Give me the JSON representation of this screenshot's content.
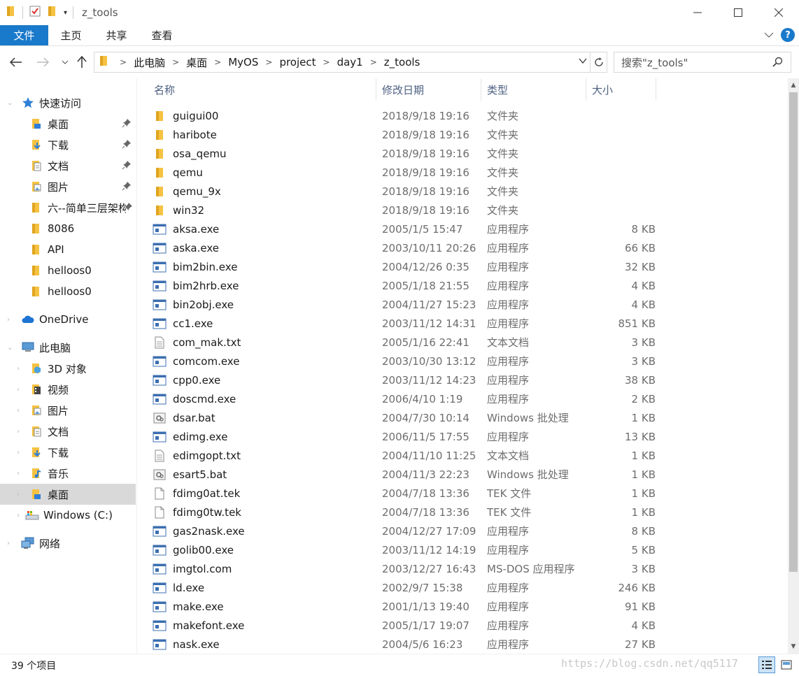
{
  "window": {
    "title": "z_tools"
  },
  "ribbon": {
    "tabs": [
      {
        "label": "文件"
      },
      {
        "label": "主页"
      },
      {
        "label": "共享"
      },
      {
        "label": "查看"
      }
    ],
    "accent": "#1979ca"
  },
  "address": {
    "crumbs": [
      "此电脑",
      "桌面",
      "MyOS",
      "project",
      "day1",
      "z_tools"
    ],
    "search_placeholder": "搜索\"z_tools\""
  },
  "sidebar": {
    "quick_access": {
      "label": "快速访问",
      "icon": "star-icon"
    },
    "quick_items": [
      {
        "label": "桌面",
        "icon": "desktop-folder-icon",
        "pinned": true
      },
      {
        "label": "下载",
        "icon": "download-folder-icon",
        "pinned": true
      },
      {
        "label": "文档",
        "icon": "documents-folder-icon",
        "pinned": true
      },
      {
        "label": "图片",
        "icon": "pictures-folder-icon",
        "pinned": true
      },
      {
        "label": "六--简单三层架构",
        "icon": "folder-icon",
        "pinned": true
      },
      {
        "label": "8086",
        "icon": "folder-icon",
        "pinned": false
      },
      {
        "label": "API",
        "icon": "folder-icon",
        "pinned": false
      },
      {
        "label": "helloos0",
        "icon": "folder-icon",
        "pinned": false
      },
      {
        "label": "helloos0",
        "icon": "folder-icon",
        "pinned": false
      }
    ],
    "onedrive": {
      "label": "OneDrive",
      "icon": "cloud-icon"
    },
    "this_pc": {
      "label": "此电脑",
      "icon": "computer-icon"
    },
    "pc_items": [
      {
        "label": "3D 对象",
        "icon": "3d-objects-icon"
      },
      {
        "label": "视频",
        "icon": "videos-folder-icon"
      },
      {
        "label": "图片",
        "icon": "pictures-folder-icon"
      },
      {
        "label": "文档",
        "icon": "documents-folder-icon"
      },
      {
        "label": "下载",
        "icon": "download-folder-icon"
      },
      {
        "label": "音乐",
        "icon": "music-folder-icon"
      },
      {
        "label": "桌面",
        "icon": "desktop-folder-icon",
        "selected": true
      },
      {
        "label": "Windows (C:)",
        "icon": "drive-icon"
      }
    ],
    "network": {
      "label": "网络",
      "icon": "network-icon"
    }
  },
  "columns": {
    "name": "名称",
    "date": "修改日期",
    "type": "类型",
    "size": "大小"
  },
  "files": [
    {
      "name": "guigui00",
      "date": "2018/9/18 19:16",
      "type": "文件夹",
      "size": "",
      "kind": "folder"
    },
    {
      "name": "haribote",
      "date": "2018/9/18 19:16",
      "type": "文件夹",
      "size": "",
      "kind": "folder"
    },
    {
      "name": "osa_qemu",
      "date": "2018/9/18 19:16",
      "type": "文件夹",
      "size": "",
      "kind": "folder"
    },
    {
      "name": "qemu",
      "date": "2018/9/18 19:16",
      "type": "文件夹",
      "size": "",
      "kind": "folder"
    },
    {
      "name": "qemu_9x",
      "date": "2018/9/18 19:16",
      "type": "文件夹",
      "size": "",
      "kind": "folder"
    },
    {
      "name": "win32",
      "date": "2018/9/18 19:16",
      "type": "文件夹",
      "size": "",
      "kind": "folder"
    },
    {
      "name": "aksa.exe",
      "date": "2005/1/5 15:47",
      "type": "应用程序",
      "size": "8 KB",
      "kind": "exe"
    },
    {
      "name": "aska.exe",
      "date": "2003/10/11 20:26",
      "type": "应用程序",
      "size": "66 KB",
      "kind": "exe"
    },
    {
      "name": "bim2bin.exe",
      "date": "2004/12/26 0:35",
      "type": "应用程序",
      "size": "32 KB",
      "kind": "exe"
    },
    {
      "name": "bim2hrb.exe",
      "date": "2005/1/18 21:55",
      "type": "应用程序",
      "size": "4 KB",
      "kind": "exe"
    },
    {
      "name": "bin2obj.exe",
      "date": "2004/11/27 15:23",
      "type": "应用程序",
      "size": "4 KB",
      "kind": "exe"
    },
    {
      "name": "cc1.exe",
      "date": "2003/11/12 14:31",
      "type": "应用程序",
      "size": "851 KB",
      "kind": "exe"
    },
    {
      "name": "com_mak.txt",
      "date": "2005/1/16 22:41",
      "type": "文本文档",
      "size": "3 KB",
      "kind": "txt"
    },
    {
      "name": "comcom.exe",
      "date": "2003/10/30 13:12",
      "type": "应用程序",
      "size": "3 KB",
      "kind": "exe"
    },
    {
      "name": "cpp0.exe",
      "date": "2003/11/12 14:23",
      "type": "应用程序",
      "size": "38 KB",
      "kind": "exe"
    },
    {
      "name": "doscmd.exe",
      "date": "2006/4/10 1:19",
      "type": "应用程序",
      "size": "2 KB",
      "kind": "exe"
    },
    {
      "name": "dsar.bat",
      "date": "2004/7/30 10:14",
      "type": "Windows 批处理",
      "size": "1 KB",
      "kind": "bat"
    },
    {
      "name": "edimg.exe",
      "date": "2006/11/5 17:55",
      "type": "应用程序",
      "size": "13 KB",
      "kind": "exe"
    },
    {
      "name": "edimgopt.txt",
      "date": "2004/11/10 11:25",
      "type": "文本文档",
      "size": "1 KB",
      "kind": "txt"
    },
    {
      "name": "esart5.bat",
      "date": "2004/11/3 22:23",
      "type": "Windows 批处理",
      "size": "1 KB",
      "kind": "bat"
    },
    {
      "name": "fdimg0at.tek",
      "date": "2004/7/18 13:36",
      "type": "TEK 文件",
      "size": "1 KB",
      "kind": "blank"
    },
    {
      "name": "fdimg0tw.tek",
      "date": "2004/7/18 13:36",
      "type": "TEK 文件",
      "size": "1 KB",
      "kind": "blank"
    },
    {
      "name": "gas2nask.exe",
      "date": "2004/12/27 17:09",
      "type": "应用程序",
      "size": "8 KB",
      "kind": "exe"
    },
    {
      "name": "golib00.exe",
      "date": "2003/11/12 14:19",
      "type": "应用程序",
      "size": "5 KB",
      "kind": "exe"
    },
    {
      "name": "imgtol.com",
      "date": "2003/12/27 16:43",
      "type": "MS-DOS 应用程序",
      "size": "3 KB",
      "kind": "exe"
    },
    {
      "name": "ld.exe",
      "date": "2002/9/7 15:38",
      "type": "应用程序",
      "size": "246 KB",
      "kind": "exe"
    },
    {
      "name": "make.exe",
      "date": "2001/1/13 19:40",
      "type": "应用程序",
      "size": "91 KB",
      "kind": "exe"
    },
    {
      "name": "makefont.exe",
      "date": "2005/1/17 19:07",
      "type": "应用程序",
      "size": "4 KB",
      "kind": "exe"
    },
    {
      "name": "nask.exe",
      "date": "2004/5/6 16:23",
      "type": "应用程序",
      "size": "27 KB",
      "kind": "exe"
    }
  ],
  "status": {
    "count": "39 个项目",
    "watermark": "https://blog.csdn.net/qq5117"
  }
}
